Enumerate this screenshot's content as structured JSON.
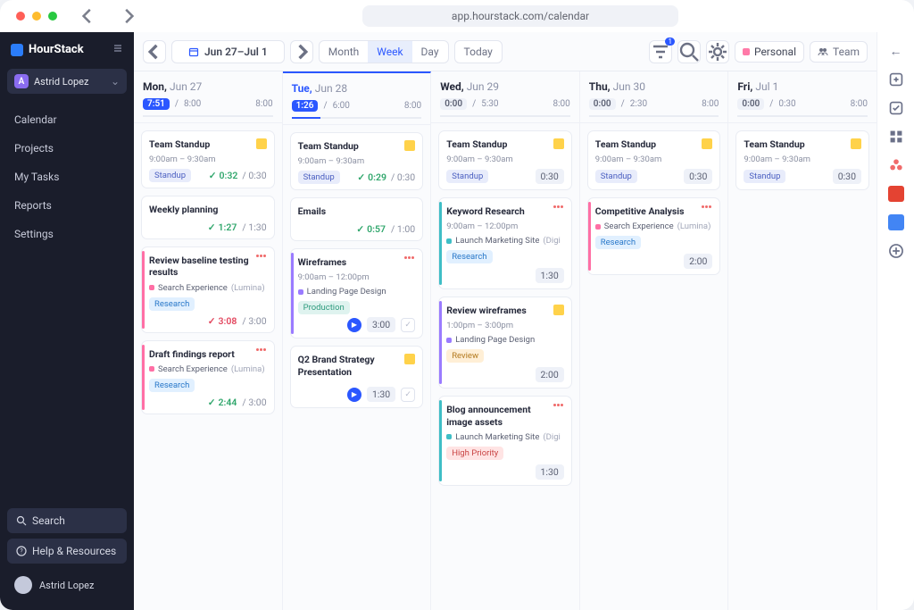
{
  "url": "app.hourstack.com/calendar",
  "brand": "HourStack",
  "workspace": {
    "initial": "A",
    "name": "Astrid Lopez"
  },
  "nav": {
    "calendar": "Calendar",
    "projects": "Projects",
    "tasks": "My Tasks",
    "reports": "Reports",
    "settings": "Settings"
  },
  "sidebar": {
    "search": "Search",
    "help": "Help & Resources",
    "user": "Astrid Lopez"
  },
  "toolbar": {
    "range": "Jun 27–Jul 1",
    "month": "Month",
    "week": "Week",
    "day": "Day",
    "today": "Today",
    "personal": "Personal",
    "team": "Team",
    "filter_badge": "1"
  },
  "days": {
    "mon": {
      "wd": "Mon,",
      "dt": "Jun 27",
      "logged": "7:51",
      "sched": "8:00",
      "cap": "8:00",
      "pct": "95%"
    },
    "tue": {
      "wd": "Tue,",
      "dt": "Jun 28",
      "logged": "1:26",
      "sched": "6:00",
      "cap": "8:00",
      "pct": "22%"
    },
    "wed": {
      "wd": "Wed,",
      "dt": "Jun 29",
      "logged": "0:00",
      "sched": "5:30",
      "cap": "8:00",
      "pct": "0%"
    },
    "thu": {
      "wd": "Thu,",
      "dt": "Jun 30",
      "logged": "0:00",
      "sched": "2:30",
      "cap": "8:00",
      "pct": "0%"
    },
    "fri": {
      "wd": "Fri,",
      "dt": "Jul 1",
      "logged": "0:00",
      "sched": "0:30",
      "cap": "8:00",
      "pct": "0%"
    }
  },
  "cards": {
    "standup": {
      "title": "Team Standup",
      "time": "9:00am – 9:30am",
      "chip": "Standup"
    },
    "mon": {
      "standup_done": "0:32",
      "standup_est": "/ 0:30",
      "weekly": {
        "title": "Weekly planning",
        "done": "1:27",
        "est": "/ 1:30"
      },
      "review": {
        "title": "Review baseline testing results",
        "proj": "Search Experience",
        "client": "(Lumina)",
        "chip": "Research",
        "done": "3:08",
        "est": "/ 3:00"
      },
      "draft": {
        "title": "Draft findings report",
        "proj": "Search Experience",
        "client": "(Lumina)",
        "chip": "Research",
        "done": "2:44",
        "est": "/ 3:00"
      }
    },
    "tue": {
      "standup_done": "0:29",
      "standup_est": "/ 0:30",
      "emails": {
        "title": "Emails",
        "done": "0:57",
        "est": "/ 1:00"
      },
      "wireframes": {
        "title": "Wireframes",
        "time": "9:00am – 12:00pm",
        "proj": "Landing Page Design",
        "chip": "Production",
        "play": "3:00"
      },
      "q2": {
        "title": "Q2 Brand Strategy Presentation",
        "play": "1:30"
      }
    },
    "wed": {
      "standup_est": "0:30",
      "keyword": {
        "title": "Keyword Research",
        "time": "9:00am – 12:00pm",
        "proj": "Launch Marketing Site",
        "client": "(Digi",
        "chip": "Research",
        "est": "1:30"
      },
      "reviewwf": {
        "title": "Review wireframes",
        "time": "1:00pm – 3:00pm",
        "proj": "Landing Page Design",
        "chip": "Review",
        "est": "2:00"
      },
      "blog": {
        "title": "Blog announcement image assets",
        "proj": "Launch Marketing Site",
        "client": "(Digi",
        "chip": "High Priority",
        "est": "1:30"
      }
    },
    "thu": {
      "standup_est": "0:30",
      "comp": {
        "title": "Competitive Analysis",
        "proj": "Search Experience",
        "client": "(Lumina)",
        "chip": "Research",
        "est": "2:00"
      }
    },
    "fri": {
      "standup_est": "0:30"
    }
  }
}
